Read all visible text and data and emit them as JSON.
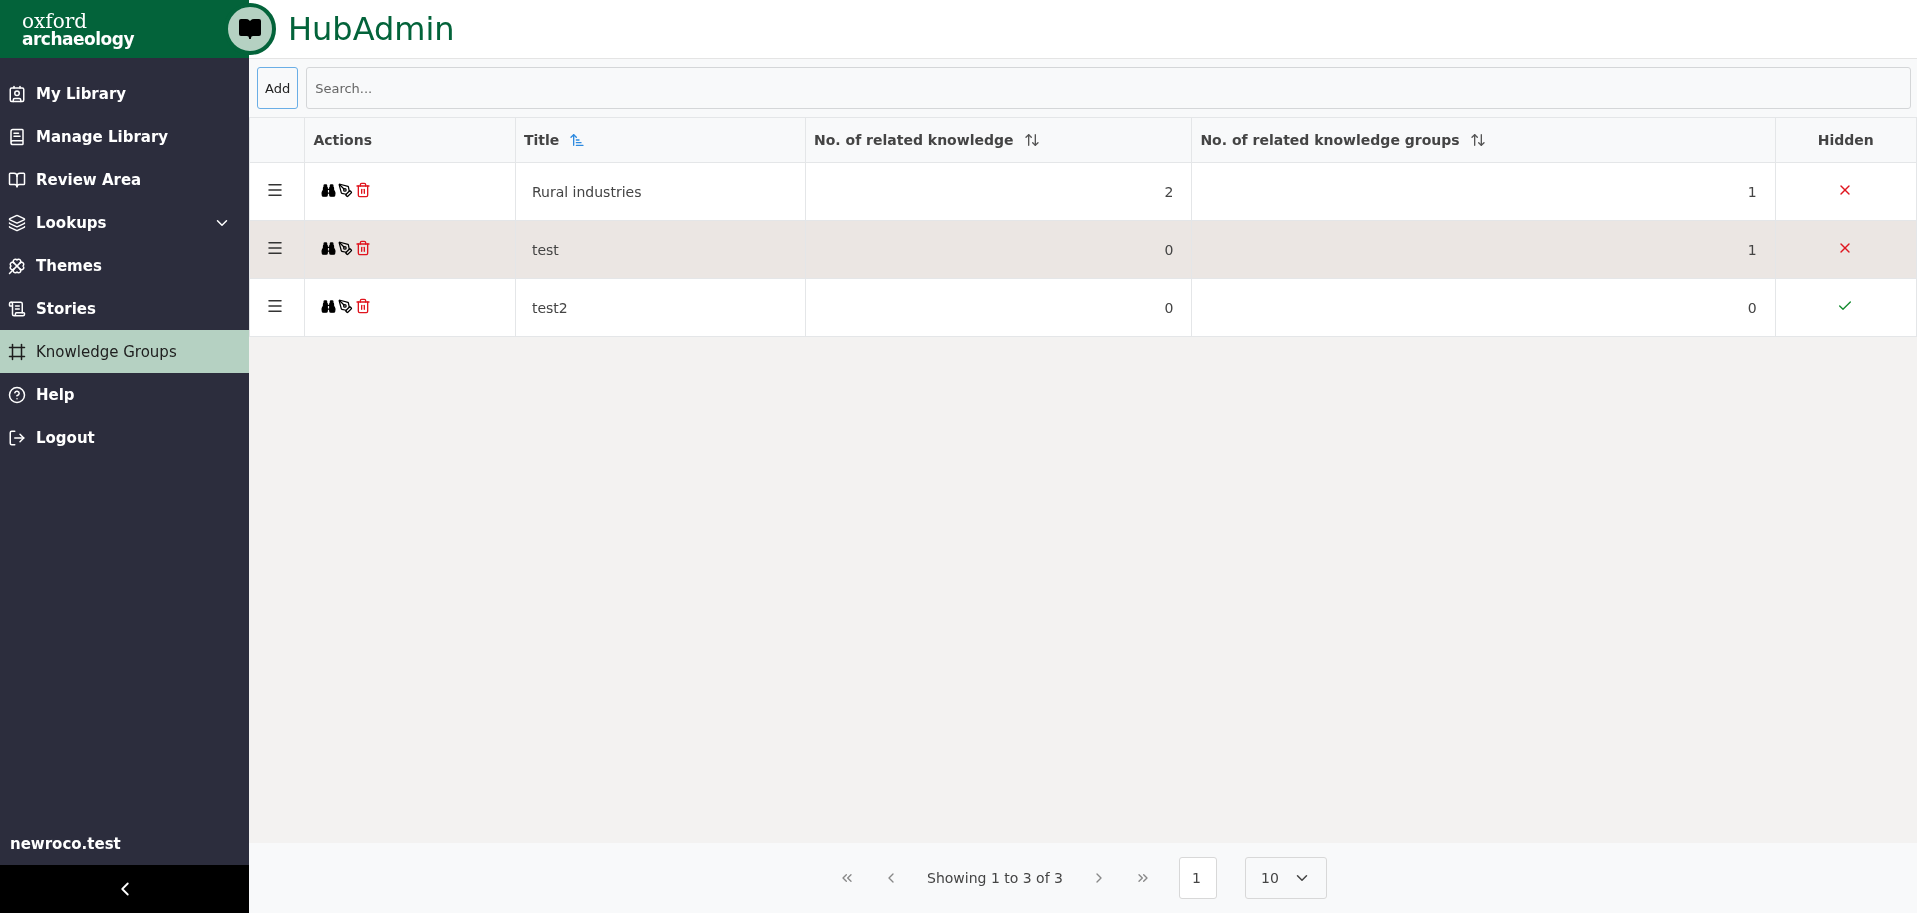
{
  "brand": {
    "line_1": "oxford",
    "line_2": "archaeology"
  },
  "app_title": "HubAdmin",
  "sidebar": {
    "items": [
      {
        "label": "My Library",
        "kind": "link",
        "selected": false
      },
      {
        "label": "Manage Library",
        "kind": "link",
        "selected": false
      },
      {
        "label": "Review Area",
        "kind": "link",
        "selected": false
      },
      {
        "label": "Lookups",
        "kind": "group",
        "selected": false
      },
      {
        "label": "Themes",
        "kind": "link",
        "selected": false
      },
      {
        "label": "Stories",
        "kind": "link",
        "selected": false
      },
      {
        "label": "Knowledge Groups",
        "kind": "link",
        "selected": true
      },
      {
        "label": "Help",
        "kind": "link",
        "selected": false
      },
      {
        "label": "Logout",
        "kind": "link",
        "selected": false
      }
    ],
    "user": "newroco.test"
  },
  "toolbar": {
    "add_button": "Add",
    "search": {
      "placeholder": "Search..."
    }
  },
  "table": {
    "columns": [
      {
        "label": "Actions"
      },
      {
        "label": "Title",
        "sortable": true,
        "sorted": true
      },
      {
        "label": "No. of related knowledge",
        "sortable": true,
        "sorted": false
      },
      {
        "label": "No. of related knowledge groups",
        "sortable": true,
        "sorted": false
      },
      {
        "label": "Hidden"
      }
    ],
    "rows": [
      {
        "title": "Rural industries",
        "related_knowledge": "2",
        "related_groups": "1",
        "hidden": false,
        "selected": false
      },
      {
        "title": "test",
        "related_knowledge": "0",
        "related_groups": "1",
        "hidden": false,
        "selected": true
      },
      {
        "title": "test2",
        "related_knowledge": "0",
        "related_groups": "0",
        "hidden": true,
        "selected": false
      }
    ]
  },
  "pagination": {
    "summary": "Showing 1 to 3 of 3",
    "page": "1",
    "page_size": "10"
  }
}
